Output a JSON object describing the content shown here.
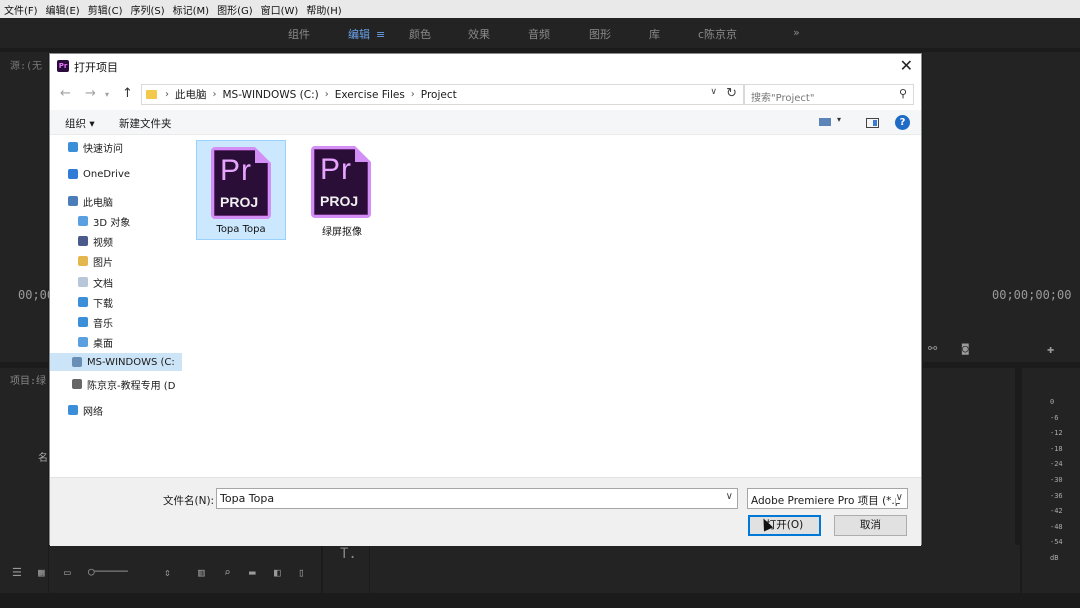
{
  "menu": [
    "文件(F)",
    "编辑(E)",
    "剪辑(C)",
    "序列(S)",
    "标记(M)",
    "图形(G)",
    "窗口(W)",
    "帮助(H)"
  ],
  "workspaces": {
    "items": [
      "组件",
      "编辑",
      "颜色",
      "效果",
      "音频",
      "图形",
      "库",
      "c陈京京"
    ],
    "active": "编辑",
    "more": "»"
  },
  "background": {
    "timecode_left": "00;00",
    "timecode_right": "00;00;00;00",
    "project_tab": "项目:绿",
    "source_tab": "源:(无",
    "col_name": "名",
    "text_tool": "T.",
    "meter_scale": [
      "0",
      "-6",
      "-12",
      "-18",
      "-24",
      "-30",
      "-36",
      "-42",
      "-48",
      "-54",
      "dB"
    ]
  },
  "dialog": {
    "title": "打开项目",
    "breadcrumb": [
      "此电脑",
      "MS-WINDOWS (C:)",
      "Exercise Files",
      "Project"
    ],
    "search_placeholder": "搜索\"Project\"",
    "toolbar": {
      "organize": "组织 ▾",
      "new_folder": "新建文件夹"
    },
    "sidebar": [
      {
        "label": "快速访问",
        "icon": "star-icon",
        "color": "#3b8fd9"
      },
      {
        "label": "OneDrive",
        "icon": "cloud-icon",
        "color": "#2f7bd6"
      },
      {
        "label": "此电脑",
        "icon": "computer-icon",
        "color": "#4b7db8"
      },
      {
        "label": "3D 对象",
        "icon": "3d-objects-icon",
        "color": "#5aa0e0"
      },
      {
        "label": "视频",
        "icon": "video-icon",
        "color": "#4a5a8a"
      },
      {
        "label": "图片",
        "icon": "pictures-icon",
        "color": "#e4b64e"
      },
      {
        "label": "文档",
        "icon": "documents-icon",
        "color": "#b8c6da"
      },
      {
        "label": "下载",
        "icon": "download-icon",
        "color": "#3b8fd9"
      },
      {
        "label": "音乐",
        "icon": "music-icon",
        "color": "#3b8fd9"
      },
      {
        "label": "桌面",
        "icon": "desktop-icon",
        "color": "#5aa0e0"
      },
      {
        "label": "MS-WINDOWS (C:",
        "icon": "drive-c-icon",
        "color": "#6a8fb6"
      },
      {
        "label": "陈京京-教程专用 (D",
        "icon": "drive-d-icon",
        "color": "#666666"
      },
      {
        "label": "网络",
        "icon": "network-icon",
        "color": "#3b8fd9"
      }
    ],
    "files": [
      {
        "name": "Topa Topa",
        "badge": "Pr",
        "ext": "PROJ"
      },
      {
        "name": "绿屏抠像",
        "badge": "Pr",
        "ext": "PROJ"
      }
    ],
    "filename_label": "文件名(N):",
    "filename_value": "Topa Topa",
    "filetype": "Adobe Premiere Pro 项目 (*.p",
    "open_button": "打开(O)",
    "cancel_button": "取消"
  }
}
